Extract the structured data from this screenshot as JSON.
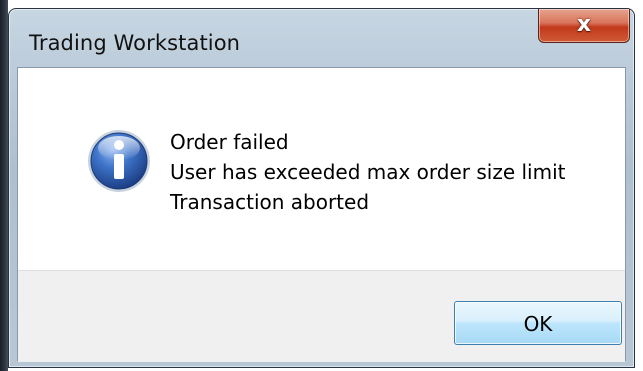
{
  "window": {
    "title": "Trading Workstation",
    "close_glyph": "x"
  },
  "dialog": {
    "icon": "information-icon",
    "lines": [
      "Order failed",
      "User has exceeded max order size limit",
      "Transaction aborted"
    ],
    "ok_label": "OK"
  },
  "colors": {
    "close_button": "#c9482a",
    "ok_button_border": "#3c7fb1",
    "info_icon": "#2f5fb0"
  }
}
